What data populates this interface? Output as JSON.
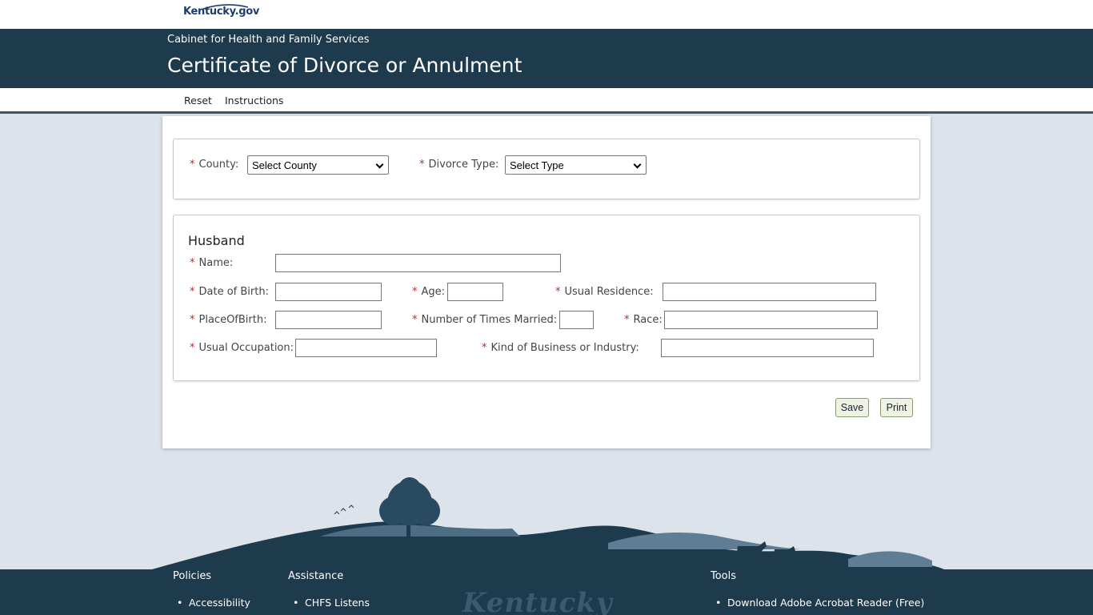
{
  "site": {
    "logo_text": "Kentucky.gov"
  },
  "header": {
    "cabinet": "Cabinet for Health and Family Services",
    "title": "Certificate of Divorce or Annulment"
  },
  "nav": {
    "reset": "Reset",
    "instructions": "Instructions"
  },
  "filters": {
    "county_label": "County:",
    "county_value": "Select County",
    "divorce_type_label": "Divorce Type:",
    "divorce_type_value": "Select Type"
  },
  "husband": {
    "section_title": "Husband",
    "name_label": "Name:",
    "dob_label": "Date of Birth:",
    "age_label": "Age:",
    "residence_label": "Usual Residence:",
    "place_of_birth_label": "PlaceOfBirth:",
    "times_married_label": "Number of Times Married:",
    "race_label": "Race:",
    "occupation_label": "Usual Occupation:",
    "business_label": "Kind of Business or Industry:"
  },
  "required_marker": "*",
  "actions": {
    "save": "Save",
    "print": "Print"
  },
  "footer": {
    "policies": {
      "heading": "Policies",
      "items": [
        "Accessibility"
      ]
    },
    "assistance": {
      "heading": "Assistance",
      "items": [
        "CHFS Listens"
      ]
    },
    "tools": {
      "heading": "Tools",
      "items": [
        "Download Adobe Acrobat Reader (Free)"
      ]
    },
    "watermark": "Kentucky"
  },
  "colors": {
    "header_bg": "#1e3a4d",
    "page_bg": "#dde3ea",
    "required": "#b03030",
    "button_bg": "#eef3e4"
  }
}
